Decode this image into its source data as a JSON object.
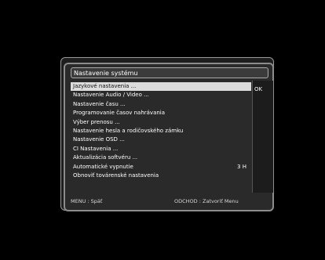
{
  "dialog": {
    "title": "Nastavenie systému",
    "items": [
      {
        "label": "Jazykové nastavenia ...",
        "value": ""
      },
      {
        "label": "Nastavenie Audio / Video ...",
        "value": ""
      },
      {
        "label": "Nastavenie času ...",
        "value": ""
      },
      {
        "label": "Programovanie časov nahrávania",
        "value": ""
      },
      {
        "label": "Výber prenosu ...",
        "value": ""
      },
      {
        "label": "Nastavenie hesla a rodičovského zámku",
        "value": ""
      },
      {
        "label": "Nastavenie OSD ...",
        "value": ""
      },
      {
        "label": "CI Nastavenia ...",
        "value": ""
      },
      {
        "label": "Aktualizácia softvéru ...",
        "value": ""
      },
      {
        "label": "Automatické vypnutie",
        "value": "3 H"
      },
      {
        "label": "Obnoviť továrenské nastavenia",
        "value": ""
      }
    ],
    "selected_index": 0,
    "side": {
      "ok": "OK"
    },
    "footer": {
      "menu_hint": "MENU   : Späť",
      "exit_hint": "ODCHOD : Zatvoriť Menu"
    }
  },
  "colors": {
    "background": "#000000",
    "panel": "#2a2a2a",
    "selection": "#dcdcdc",
    "border": "#8c8c8c"
  }
}
